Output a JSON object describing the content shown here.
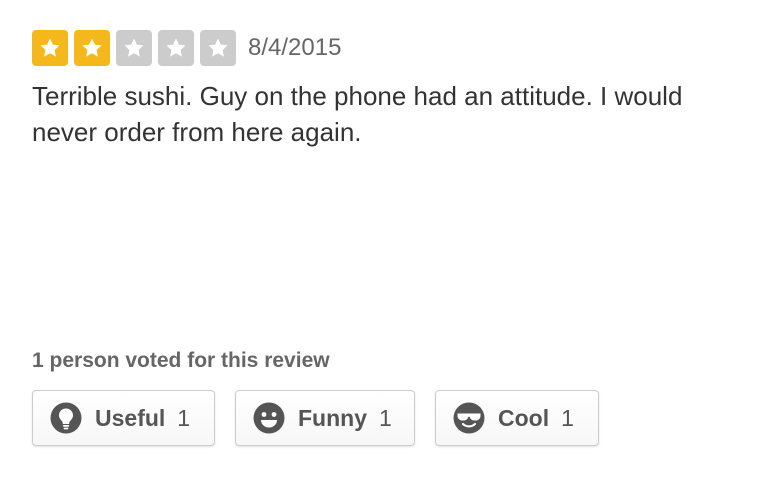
{
  "review": {
    "rating": 2,
    "max_rating": 5,
    "date": "8/4/2015",
    "text": "Terrible sushi. Guy on the phone had an attitude. I would never order from here again."
  },
  "votes": {
    "caption": "1 person voted for this review",
    "buttons": [
      {
        "label": "Useful",
        "count": "1",
        "icon": "lightbulb-icon"
      },
      {
        "label": "Funny",
        "count": "1",
        "icon": "smiley-face-icon"
      },
      {
        "label": "Cool",
        "count": "1",
        "icon": "sunglasses-face-icon"
      }
    ]
  },
  "colors": {
    "star_filled": "#f5b81c",
    "star_empty": "#cccccc"
  }
}
